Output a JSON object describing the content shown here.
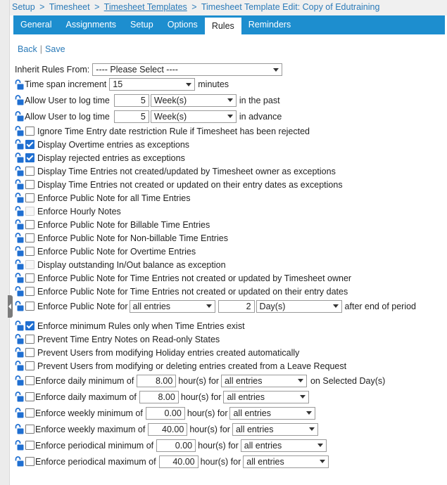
{
  "breadcrumb": {
    "items": [
      "Setup",
      "Timesheet",
      "Timesheet Templates",
      "Timesheet Template Edit: Copy of Edutraining"
    ],
    "separator": ">"
  },
  "tabs": [
    "General",
    "Assignments",
    "Setup",
    "Options",
    "Rules",
    "Reminders"
  ],
  "active_tab": "Rules",
  "actions": {
    "back": "Back",
    "divider": "|",
    "save": "Save"
  },
  "inherit": {
    "label": "Inherit Rules From:",
    "value": "---- Please Select ----"
  },
  "timespan": {
    "label": "Time span increment",
    "value": "15",
    "unit": "minutes"
  },
  "log_past": {
    "label": "Allow User to log time",
    "value": "5",
    "unit": "Week(s)",
    "suffix": "in the past"
  },
  "log_advance": {
    "label": "Allow User to log time",
    "value": "5",
    "unit": "Week(s)",
    "suffix": "in advance"
  },
  "rules": [
    {
      "label": "Ignore Time Entry date restriction Rule if Timesheet has been rejected",
      "checked": false,
      "disabled": false
    },
    {
      "label": "Display Overtime entries as exceptions",
      "checked": true,
      "disabled": false
    },
    {
      "label": "Display rejected entries as exceptions",
      "checked": true,
      "disabled": false
    },
    {
      "label": "Display Time Entries not created/updated by Timesheet owner as exceptions",
      "checked": false,
      "disabled": false
    },
    {
      "label": "Display Time Entries not created or updated on their entry dates as exceptions",
      "checked": false,
      "disabled": false
    },
    {
      "label": "Enforce Public Note for all Time Entries",
      "checked": false,
      "disabled": false
    },
    {
      "label": "Enforce Hourly Notes",
      "checked": false,
      "disabled": true
    },
    {
      "label": "Enforce Public Note for Billable Time Entries",
      "checked": false,
      "disabled": false
    },
    {
      "label": "Enforce Public Note for Non-billable Time Entries",
      "checked": false,
      "disabled": false
    },
    {
      "label": "Enforce Public Note for Overtime Entries",
      "checked": false,
      "disabled": false
    },
    {
      "label": "Display outstanding In/Out balance as exception",
      "checked": false,
      "disabled": true
    },
    {
      "label": "Enforce Public Note for Time Entries not created or updated by Timesheet owner",
      "checked": false,
      "disabled": false
    },
    {
      "label": "Enforce Public Note for Time Entries not created or updated on their entry dates",
      "checked": false,
      "disabled": false
    }
  ],
  "period_note": {
    "label": "Enforce Public Note for",
    "entries": "all entries",
    "value": "2",
    "unit": "Day(s)",
    "suffix": "after end of period"
  },
  "rules2": [
    {
      "label": "Enforce minimum Rules only when Time Entries exist",
      "checked": true
    },
    {
      "label": "Prevent Time Entry Notes on Read-only States",
      "checked": false
    },
    {
      "label": "Prevent Users from modifying Holiday entries created automatically",
      "checked": false
    },
    {
      "label": "Prevent Users from modifying or deleting entries created from a Leave Request",
      "checked": false
    }
  ],
  "limits": [
    {
      "label": "Enforce daily minimum of",
      "value": "8.00",
      "mid": "hour(s) for",
      "entries": "all entries",
      "suffix": "on Selected Day(s)"
    },
    {
      "label": "Enforce daily maximum of",
      "value": "8.00",
      "mid": "hour(s) for",
      "entries": "all entries",
      "suffix": ""
    },
    {
      "label": "Enforce weekly minimum of",
      "value": "0.00",
      "mid": "hour(s) for",
      "entries": "all entries",
      "suffix": ""
    },
    {
      "label": "Enforce weekly maximum of",
      "value": "40.00",
      "mid": "hour(s) for",
      "entries": "all entries",
      "suffix": ""
    },
    {
      "label": "Enforce periodical minimum of",
      "value": "0.00",
      "mid": "hour(s) for",
      "entries": "all entries",
      "suffix": ""
    },
    {
      "label": "Enforce periodical maximum of",
      "value": "40.00",
      "mid": "hour(s) for",
      "entries": "all entries",
      "suffix": ""
    }
  ],
  "colors": {
    "tab_bar": "#1d8ecf",
    "link": "#2a7ab8",
    "checkbox_checked": "#1f6fd1",
    "lock_icon": "#1f6fd1"
  }
}
